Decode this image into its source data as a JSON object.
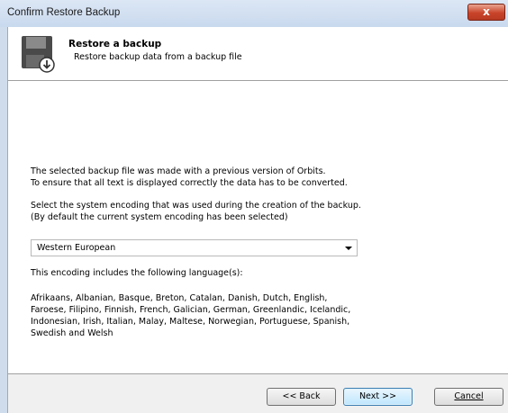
{
  "window": {
    "title": "Confirm Restore Backup",
    "close_label": "x"
  },
  "header": {
    "title": "Restore a backup",
    "subtitle": "Restore backup data from a backup file"
  },
  "content": {
    "line1": "The selected backup file was made with a previous version of Orbits.",
    "line2": "To ensure that all text is displayed correctly the data has to be converted.",
    "line3": "Select the system encoding that was used during the creation of the backup.",
    "line4": "(By default the current system encoding has been selected)",
    "encoding_value": "Western European",
    "languages_intro": "This encoding includes the following language(s):",
    "languages_lines": [
      "Afrikaans, Albanian, Basque, Breton, Catalan, Danish, Dutch, English,",
      "Faroese, Filipino, Finnish, French, Galician, German, Greenlandic, Icelandic,",
      "Indonesian, Irish, Italian, Malay, Maltese, Norwegian, Portuguese, Spanish,",
      "Swedish and Welsh"
    ]
  },
  "buttons": {
    "back": "<< Back",
    "next": "Next >>",
    "cancel": "Cancel"
  },
  "icons": {
    "header": "floppy-restore-icon",
    "close": "close-icon",
    "dropdown": "chevron-down-icon"
  }
}
